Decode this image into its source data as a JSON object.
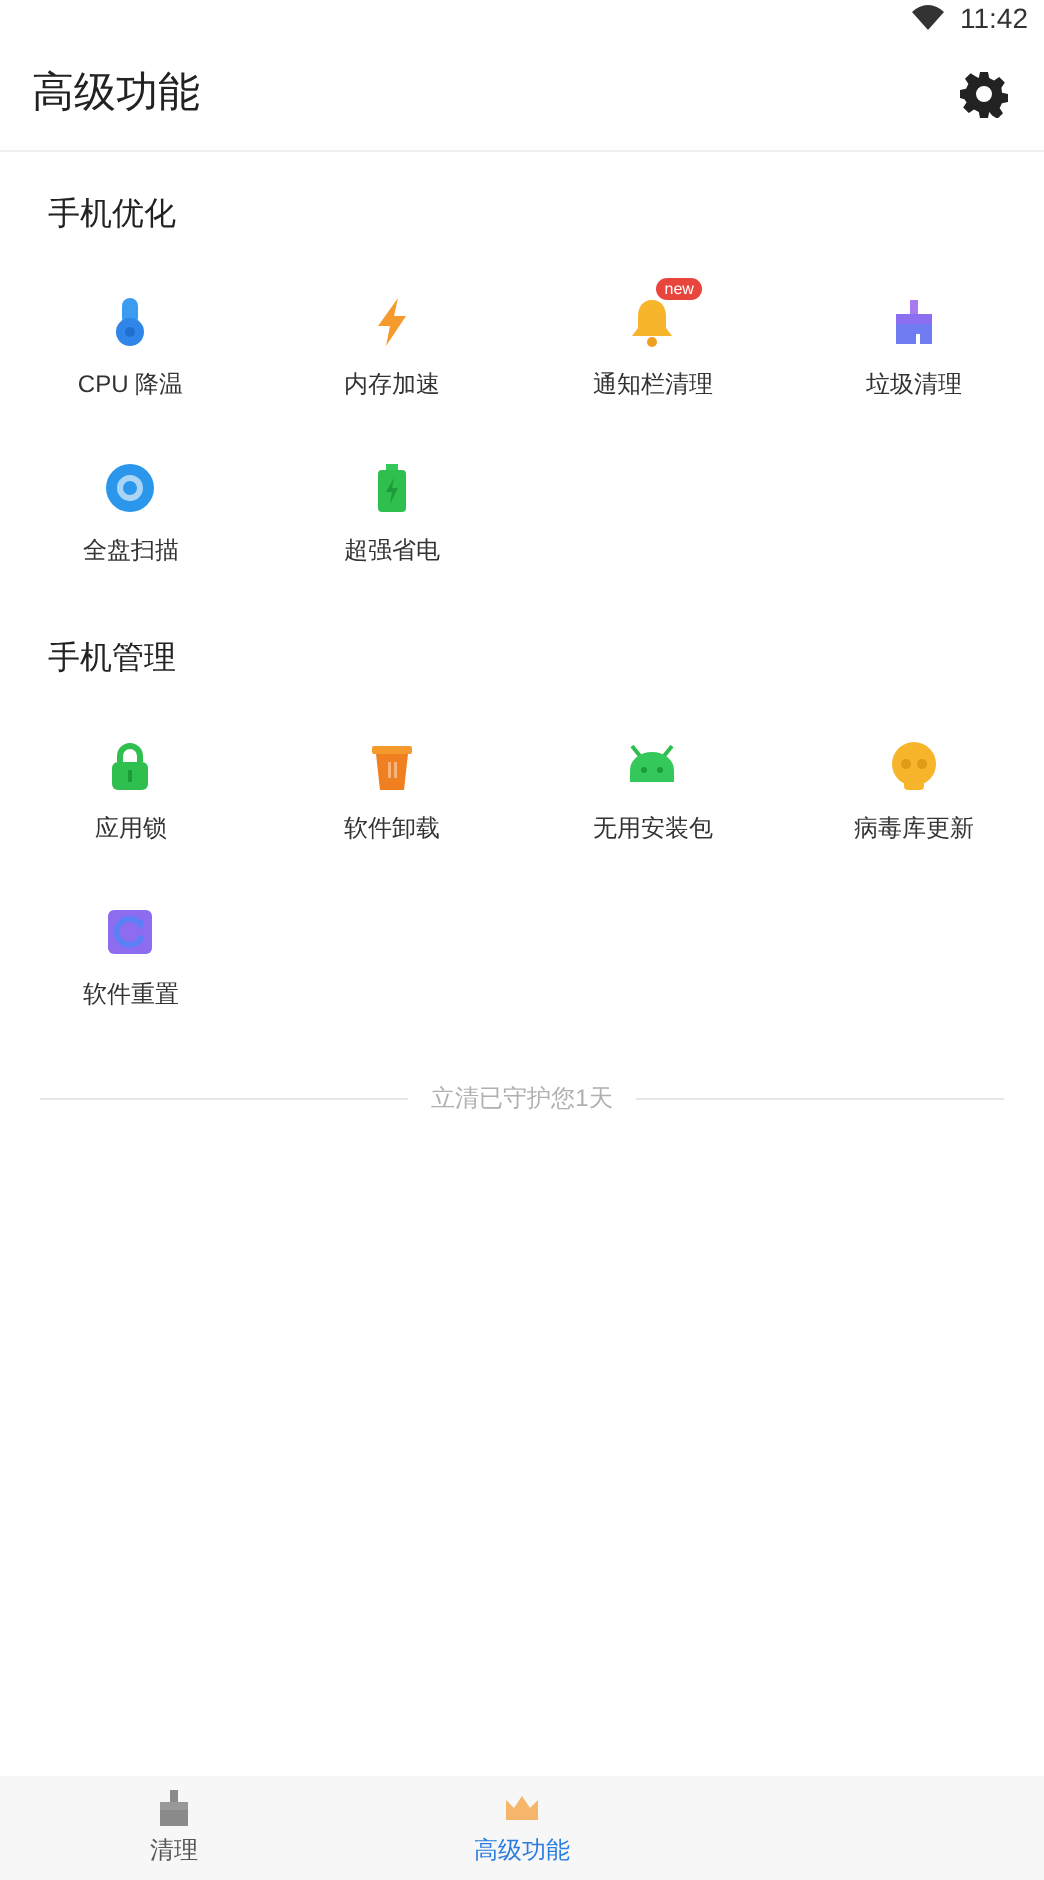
{
  "status_bar": {
    "time": "11:42"
  },
  "header": {
    "title": "高级功能"
  },
  "sections": [
    {
      "title": "手机优化",
      "tools": [
        {
          "label": "CPU 降温",
          "kind": "thermometer"
        },
        {
          "label": "内存加速",
          "kind": "bolt"
        },
        {
          "label": "通知栏清理",
          "kind": "bell",
          "badge": "new"
        },
        {
          "label": "垃圾清理",
          "kind": "broom"
        },
        {
          "label": "全盘扫描",
          "kind": "scan"
        },
        {
          "label": "超强省电",
          "kind": "battery"
        }
      ]
    },
    {
      "title": "手机管理",
      "tools": [
        {
          "label": "应用锁",
          "kind": "lock"
        },
        {
          "label": "软件卸载",
          "kind": "trash"
        },
        {
          "label": "无用安装包",
          "kind": "android"
        },
        {
          "label": "病毒库更新",
          "kind": "skull"
        },
        {
          "label": "软件重置",
          "kind": "reset"
        }
      ]
    }
  ],
  "footer_note": "立清已守护您1天",
  "bottom_nav": [
    {
      "label": "清理",
      "kind": "broom",
      "selected": false
    },
    {
      "label": "高级功能",
      "kind": "crown",
      "selected": true
    }
  ]
}
